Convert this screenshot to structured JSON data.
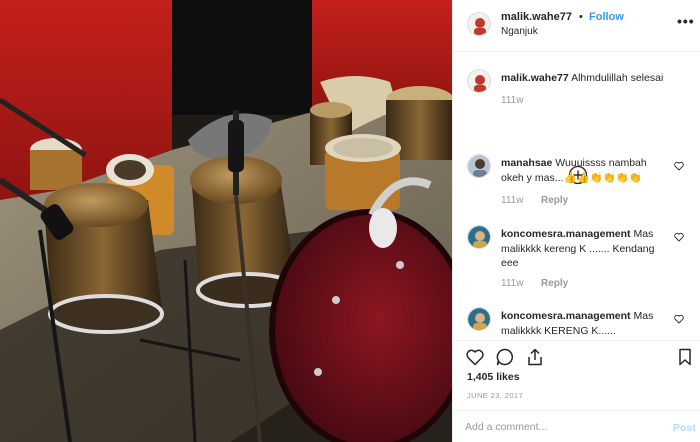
{
  "post": {
    "image_alt": "photo",
    "username": "malik.wahe77",
    "follow_label": "Follow",
    "location": "Nganjuk",
    "more_icon": "ellipsis-icon"
  },
  "caption": {
    "username": "malik.wahe77",
    "text": "Alhmdulillah selesai",
    "time": "111w"
  },
  "comments": [
    {
      "username": "manahsae",
      "text": "Wuuuissss nambah okeh y mas...👍👍👏👏👏👏",
      "time": "111w",
      "reply_label": "Reply"
    },
    {
      "username": "koncomesra.management",
      "text": "Mas malikkkk kereng K ....... Kendang eee",
      "time": "111w",
      "reply_label": "Reply"
    },
    {
      "username": "koncomesra.management",
      "text": "Mas malikkkk KERENG K...... KENDANG"
    }
  ],
  "actions": {
    "like_icon": "heart-icon",
    "comment_icon": "comment-bubble-icon",
    "share_icon": "share-upload-icon",
    "save_icon": "bookmark-icon"
  },
  "likes": "1,405 likes",
  "date": "JUNE 23, 2017",
  "add_comment": {
    "placeholder": "Add a comment...",
    "post_label": "Post"
  },
  "colors": {
    "accent": "#3897f0",
    "post_disabled": "#b3dbff",
    "muted": "#999999"
  }
}
